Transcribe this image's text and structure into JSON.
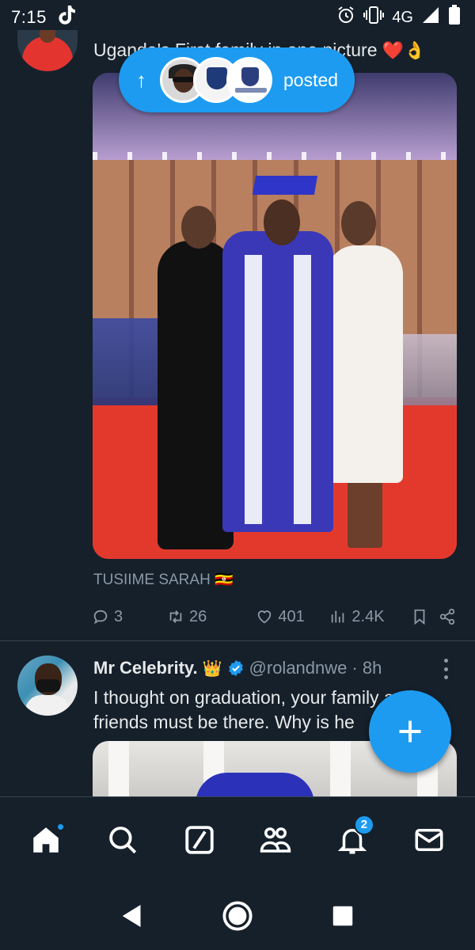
{
  "status_bar": {
    "time": "7:15",
    "network": "4G",
    "icons": [
      "tiktok-icon",
      "alarm-icon",
      "vibrate-icon",
      "signal-icon",
      "battery-icon"
    ]
  },
  "tweet1": {
    "text": "Uganda's First family in one picture",
    "emoji": "❤️👌",
    "caption": "TUSIIME SARAH 🇺🇬",
    "replies": "3",
    "retweets": "26",
    "likes": "401",
    "views": "2.4K"
  },
  "posted_pill": {
    "label": "posted"
  },
  "tweet2": {
    "name": "Mr Celebrity.",
    "crown": "👑",
    "handle": "@rolandnwe",
    "time": "· 8h",
    "text": "I thought on graduation,  your family and friends must be there. Why is he"
  },
  "bottom_nav": {
    "notifications_badge": "2",
    "items": [
      "home-icon",
      "search-icon",
      "grok-icon",
      "communities-icon",
      "notifications-icon",
      "messages-icon"
    ]
  },
  "colors": {
    "background": "#15202b",
    "accent": "#1d9bf0",
    "text": "#e7e9ea",
    "muted": "#8b98a5"
  }
}
